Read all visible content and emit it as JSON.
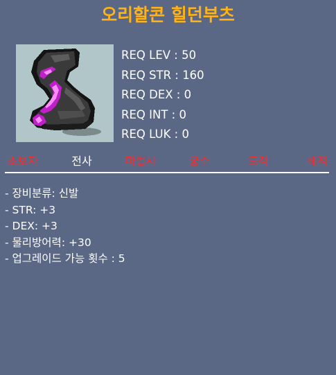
{
  "item": {
    "name": "오리할콘 힐던부츠",
    "icon": "boots-icon",
    "requirements": [
      "REQ LEV : 50",
      "REQ STR : 160",
      "REQ DEX : 0",
      "REQ INT : 0",
      "REQ LUK : 0"
    ],
    "jobs": [
      {
        "label": "초보자",
        "allowed": false
      },
      {
        "label": "전사",
        "allowed": true
      },
      {
        "label": "마법사",
        "allowed": false
      },
      {
        "label": "궁수",
        "allowed": false
      },
      {
        "label": "도적",
        "allowed": false
      },
      {
        "label": "해적",
        "allowed": false
      }
    ],
    "stats": [
      "- 장비분류: 신발",
      "- STR: +3",
      "- DEX: +3",
      "- 물리방어력: +30",
      "- 업그레이드 가능 횟수 : 5"
    ]
  },
  "colors": {
    "background": "#5a6785",
    "title": "#ffb316",
    "job_unavailable": "#ff2a2a",
    "job_available": "#ffffff"
  }
}
